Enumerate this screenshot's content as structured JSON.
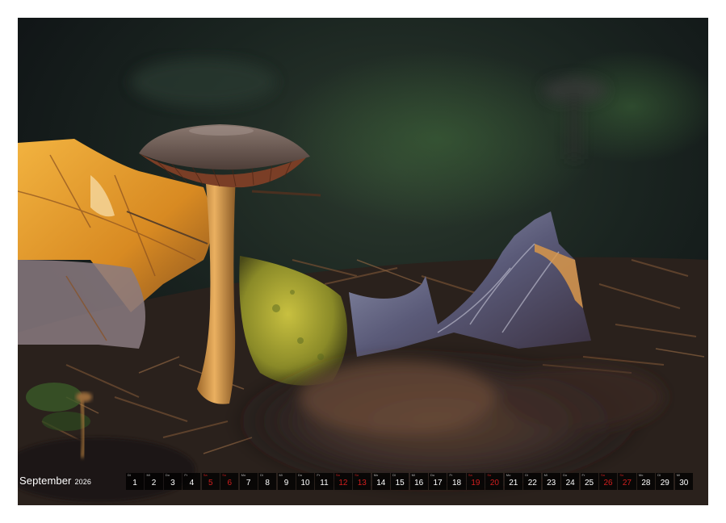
{
  "calendar": {
    "month": "September",
    "year": "2026",
    "days": [
      {
        "weekday": "Di",
        "day": "1",
        "weekend": false
      },
      {
        "weekday": "Mi",
        "day": "2",
        "weekend": false
      },
      {
        "weekday": "Do",
        "day": "3",
        "weekend": false
      },
      {
        "weekday": "Fr",
        "day": "4",
        "weekend": false
      },
      {
        "weekday": "Sa",
        "day": "5",
        "weekend": true
      },
      {
        "weekday": "So",
        "day": "6",
        "weekend": true
      },
      {
        "weekday": "Mo",
        "day": "7",
        "weekend": false
      },
      {
        "weekday": "Di",
        "day": "8",
        "weekend": false
      },
      {
        "weekday": "Mi",
        "day": "9",
        "weekend": false
      },
      {
        "weekday": "Do",
        "day": "10",
        "weekend": false
      },
      {
        "weekday": "Fr",
        "day": "11",
        "weekend": false
      },
      {
        "weekday": "Sa",
        "day": "12",
        "weekend": true
      },
      {
        "weekday": "So",
        "day": "13",
        "weekend": true
      },
      {
        "weekday": "Mo",
        "day": "14",
        "weekend": false
      },
      {
        "weekday": "Di",
        "day": "15",
        "weekend": false
      },
      {
        "weekday": "Mi",
        "day": "16",
        "weekend": false
      },
      {
        "weekday": "Do",
        "day": "17",
        "weekend": false
      },
      {
        "weekday": "Fr",
        "day": "18",
        "weekend": false
      },
      {
        "weekday": "Sa",
        "day": "19",
        "weekend": true
      },
      {
        "weekday": "So",
        "day": "20",
        "weekend": true
      },
      {
        "weekday": "Mo",
        "day": "21",
        "weekend": false
      },
      {
        "weekday": "Di",
        "day": "22",
        "weekend": false
      },
      {
        "weekday": "Mi",
        "day": "23",
        "weekend": false
      },
      {
        "weekday": "Do",
        "day": "24",
        "weekend": false
      },
      {
        "weekday": "Fr",
        "day": "25",
        "weekend": false
      },
      {
        "weekday": "Sa",
        "day": "26",
        "weekend": true
      },
      {
        "weekday": "So",
        "day": "27",
        "weekend": true
      },
      {
        "weekday": "Mo",
        "day": "28",
        "weekend": false
      },
      {
        "weekday": "Di",
        "day": "29",
        "weekend": false
      },
      {
        "weekday": "Mi",
        "day": "30",
        "weekend": false
      }
    ]
  },
  "photo": {
    "subject": "mushroom-icon",
    "colors": {
      "background": "#14181c",
      "leaf_glow": "#e8a030",
      "mushroom_cap": "#6e5a52",
      "mushroom_gills": "#8a4a2e",
      "mushroom_stem": "#d8a050",
      "green_leaf": "#a8a830",
      "weekend_red": "#d21e1e"
    }
  }
}
